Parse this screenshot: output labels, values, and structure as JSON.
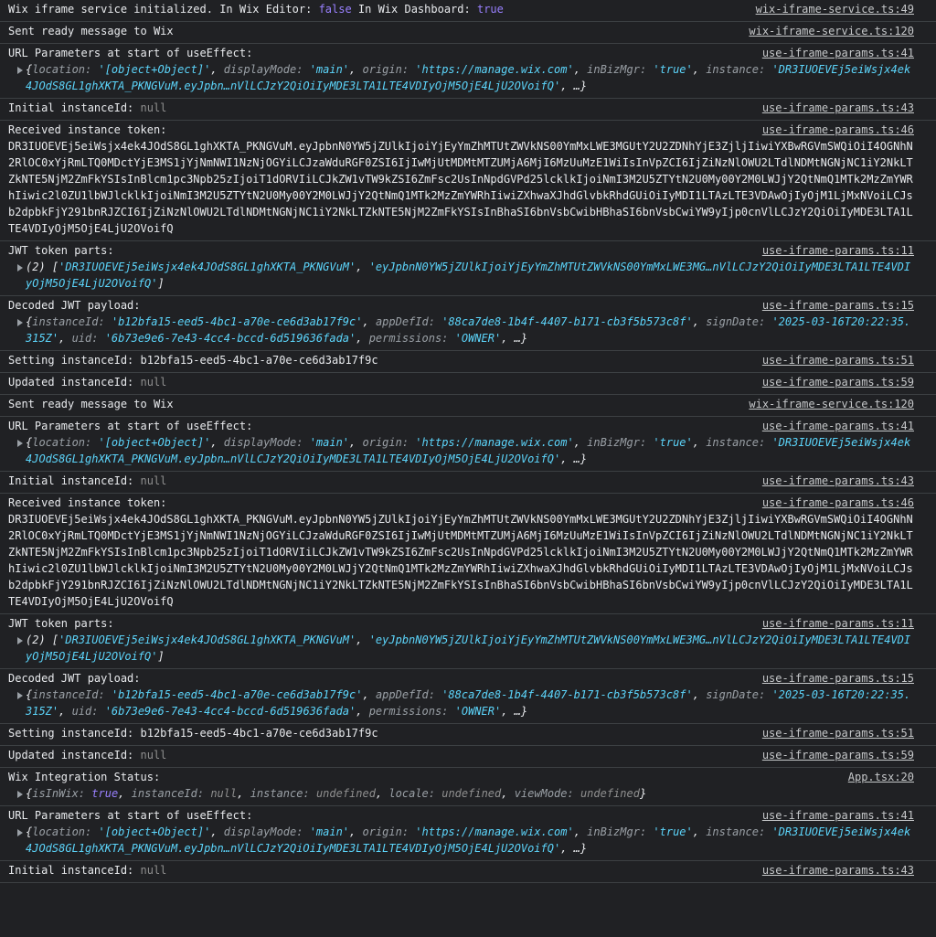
{
  "logs": [
    {
      "type": "init",
      "prefix": "Wix iframe service initialized. In Wix Editor: ",
      "editor": "false",
      "mid": " In Wix Dashboard: ",
      "dashboard": "true",
      "source": "wix-iframe-service.ts:49"
    },
    {
      "type": "text",
      "text": "Sent ready message to Wix",
      "source": "wix-iframe-service.ts:120"
    },
    {
      "type": "url",
      "text": "URL Parameters at start of useEffect:",
      "source": "use-iframe-params.ts:41",
      "location": "'[object+Object]'",
      "displayMode": "'main'",
      "origin": "'https://manage.wix.com'",
      "inBizMgr": "'true'",
      "instance": "'DR3IUOEVEj5eiWsjx4ek4JOdS8GL1ghXKTA_PKNGVuM.eyJpbn…nVlLCJzY2QiOiIyMDE3LTA1LTE4VDIyOjM5OjE4LjU2OVoifQ'"
    },
    {
      "type": "null",
      "text": "Initial instanceId: ",
      "value": "null",
      "source": "use-iframe-params.ts:43"
    },
    {
      "type": "token",
      "text": "Received instance token:",
      "token": "DR3IUOEVEj5eiWsjx4ek4JOdS8GL1ghXKTA_PKNGVuM.eyJpbnN0YW5jZUlkIjoiYjEyYmZhMTUtZWVkNS00YmMxLWE3MGUtY2U2ZDNhYjE3ZjljIiwiYXBwRGVmSWQiOiI4OGNhN2RlOC0xYjRmLTQ0MDctYjE3MS1jYjNmNWI1NzNjOGYiLCJzaWduRGF0ZSI6IjIwMjUtMDMtMTZUMjA6MjI6MzUuMzE1WiIsInVpZCI6IjZiNzNlOWU2LTdlNDMtNGNjNC1iY2NkLTZkNTE5NjM2ZmFkYSIsInBlcm1pc3Npb25zIjoiT1dORVIiLCJkZW1vTW9kZSI6ZmFsc2UsInNpdGVPd25lcklkIjoiNmI3M2U5ZTYtN2U0My00Y2M0LWJjY2QtNmQ1MTk2MzZmYWRhIiwic2l0ZU1lbWJlcklkIjoiNmI3M2U5ZTYtN2U0My00Y2M0LWJjY2QtNmQ1MTk2MzZmYWRhIiwiZXhwaXJhdGlvbkRhdGUiOiIyMDI1LTAzLTE3VDAwOjIyOjM1LjMxNVoiLCJsb2dpbkFjY291bnRJZCI6IjZiNzNlOWU2LTdlNDMtNGNjNC1iY2NkLTZkNTE5NjM2ZmFkYSIsInBhaSI6bnVsbCwibHBhaSI6bnVsbCwiYW9yIjp0cnVlLCJzY2QiOiIyMDE3LTA1LTE4VDIyOjM5OjE4LjU2OVoifQ",
      "source": "use-iframe-params.ts:46"
    },
    {
      "type": "parts",
      "text": "JWT token parts:",
      "count": "(2) ",
      "part1": "'DR3IUOEVEj5eiWsjx4ek4JOdS8GL1ghXKTA_PKNGVuM'",
      "part2": "'eyJpbnN0YW5jZUlkIjoiYjEyYmZhMTUtZWVkNS00YmMxLWE3MG…nVlLCJzY2QiOiIyMDE3LTA1LTE4VDIyOjM5OjE4LjU2OVoifQ'",
      "source": "use-iframe-params.ts:11"
    },
    {
      "type": "payload",
      "text": "Decoded JWT payload:",
      "instanceId": "'b12bfa15-eed5-4bc1-a70e-ce6d3ab17f9c'",
      "appDefId": "'88ca7de8-1b4f-4407-b171-cb3f5b573c8f'",
      "signDate": "'2025-03-16T20:22:35.315Z'",
      "uid": "'6b73e9e6-7e43-4cc4-bccd-6d519636fada'",
      "permissions": "'OWNER'",
      "source": "use-iframe-params.ts:15"
    },
    {
      "type": "text",
      "text": "Setting instanceId: b12bfa15-eed5-4bc1-a70e-ce6d3ab17f9c",
      "source": "use-iframe-params.ts:51"
    },
    {
      "type": "null",
      "text": "Updated instanceId: ",
      "value": "null",
      "source": "use-iframe-params.ts:59"
    },
    {
      "type": "text",
      "text": "Sent ready message to Wix",
      "source": "wix-iframe-service.ts:120"
    },
    {
      "type": "url",
      "text": "URL Parameters at start of useEffect:",
      "source": "use-iframe-params.ts:41",
      "location": "'[object+Object]'",
      "displayMode": "'main'",
      "origin": "'https://manage.wix.com'",
      "inBizMgr": "'true'",
      "instance": "'DR3IUOEVEj5eiWsjx4ek4JOdS8GL1ghXKTA_PKNGVuM.eyJpbn…nVlLCJzY2QiOiIyMDE3LTA1LTE4VDIyOjM5OjE4LjU2OVoifQ'"
    },
    {
      "type": "null",
      "text": "Initial instanceId: ",
      "value": "null",
      "source": "use-iframe-params.ts:43"
    },
    {
      "type": "token",
      "text": "Received instance token:",
      "token": "DR3IUOEVEj5eiWsjx4ek4JOdS8GL1ghXKTA_PKNGVuM.eyJpbnN0YW5jZUlkIjoiYjEyYmZhMTUtZWVkNS00YmMxLWE3MGUtY2U2ZDNhYjE3ZjljIiwiYXBwRGVmSWQiOiI4OGNhN2RlOC0xYjRmLTQ0MDctYjE3MS1jYjNmNWI1NzNjOGYiLCJzaWduRGF0ZSI6IjIwMjUtMDMtMTZUMjA6MjI6MzUuMzE1WiIsInVpZCI6IjZiNzNlOWU2LTdlNDMtNGNjNC1iY2NkLTZkNTE5NjM2ZmFkYSIsInBlcm1pc3Npb25zIjoiT1dORVIiLCJkZW1vTW9kZSI6ZmFsc2UsInNpdGVPd25lcklkIjoiNmI3M2U5ZTYtN2U0My00Y2M0LWJjY2QtNmQ1MTk2MzZmYWRhIiwic2l0ZU1lbWJlcklkIjoiNmI3M2U5ZTYtN2U0My00Y2M0LWJjY2QtNmQ1MTk2MzZmYWRhIiwiZXhwaXJhdGlvbkRhdGUiOiIyMDI1LTAzLTE3VDAwOjIyOjM1LjMxNVoiLCJsb2dpbkFjY291bnRJZCI6IjZiNzNlOWU2LTdlNDMtNGNjNC1iY2NkLTZkNTE5NjM2ZmFkYSIsInBhaSI6bnVsbCwibHBhaSI6bnVsbCwiYW9yIjp0cnVlLCJzY2QiOiIyMDE3LTA1LTE4VDIyOjM5OjE4LjU2OVoifQ",
      "source": "use-iframe-params.ts:46"
    },
    {
      "type": "parts",
      "text": "JWT token parts:",
      "count": "(2) ",
      "part1": "'DR3IUOEVEj5eiWsjx4ek4JOdS8GL1ghXKTA_PKNGVuM'",
      "part2": "'eyJpbnN0YW5jZUlkIjoiYjEyYmZhMTUtZWVkNS00YmMxLWE3MG…nVlLCJzY2QiOiIyMDE3LTA1LTE4VDIyOjM5OjE4LjU2OVoifQ'",
      "source": "use-iframe-params.ts:11"
    },
    {
      "type": "payload",
      "text": "Decoded JWT payload:",
      "instanceId": "'b12bfa15-eed5-4bc1-a70e-ce6d3ab17f9c'",
      "appDefId": "'88ca7de8-1b4f-4407-b171-cb3f5b573c8f'",
      "signDate": "'2025-03-16T20:22:35.315Z'",
      "uid": "'6b73e9e6-7e43-4cc4-bccd-6d519636fada'",
      "permissions": "'OWNER'",
      "source": "use-iframe-params.ts:15"
    },
    {
      "type": "text",
      "text": "Setting instanceId: b12bfa15-eed5-4bc1-a70e-ce6d3ab17f9c",
      "source": "use-iframe-params.ts:51"
    },
    {
      "type": "null",
      "text": "Updated instanceId: ",
      "value": "null",
      "source": "use-iframe-params.ts:59"
    },
    {
      "type": "status",
      "text": "Wix Integration Status:",
      "isInWix": "true",
      "instanceId": "null",
      "instance": "undefined",
      "locale": "undefined",
      "viewMode": "undefined",
      "source": "App.tsx:20"
    },
    {
      "type": "url",
      "text": "URL Parameters at start of useEffect:",
      "source": "use-iframe-params.ts:41",
      "location": "'[object+Object]'",
      "displayMode": "'main'",
      "origin": "'https://manage.wix.com'",
      "inBizMgr": "'true'",
      "instance": "'DR3IUOEVEj5eiWsjx4ek4JOdS8GL1ghXKTA_PKNGVuM.eyJpbn…nVlLCJzY2QiOiIyMDE3LTA1LTE4VDIyOjM5OjE4LjU2OVoifQ'"
    },
    {
      "type": "null",
      "text": "Initial instanceId: ",
      "value": "null",
      "source": "use-iframe-params.ts:43"
    }
  ]
}
